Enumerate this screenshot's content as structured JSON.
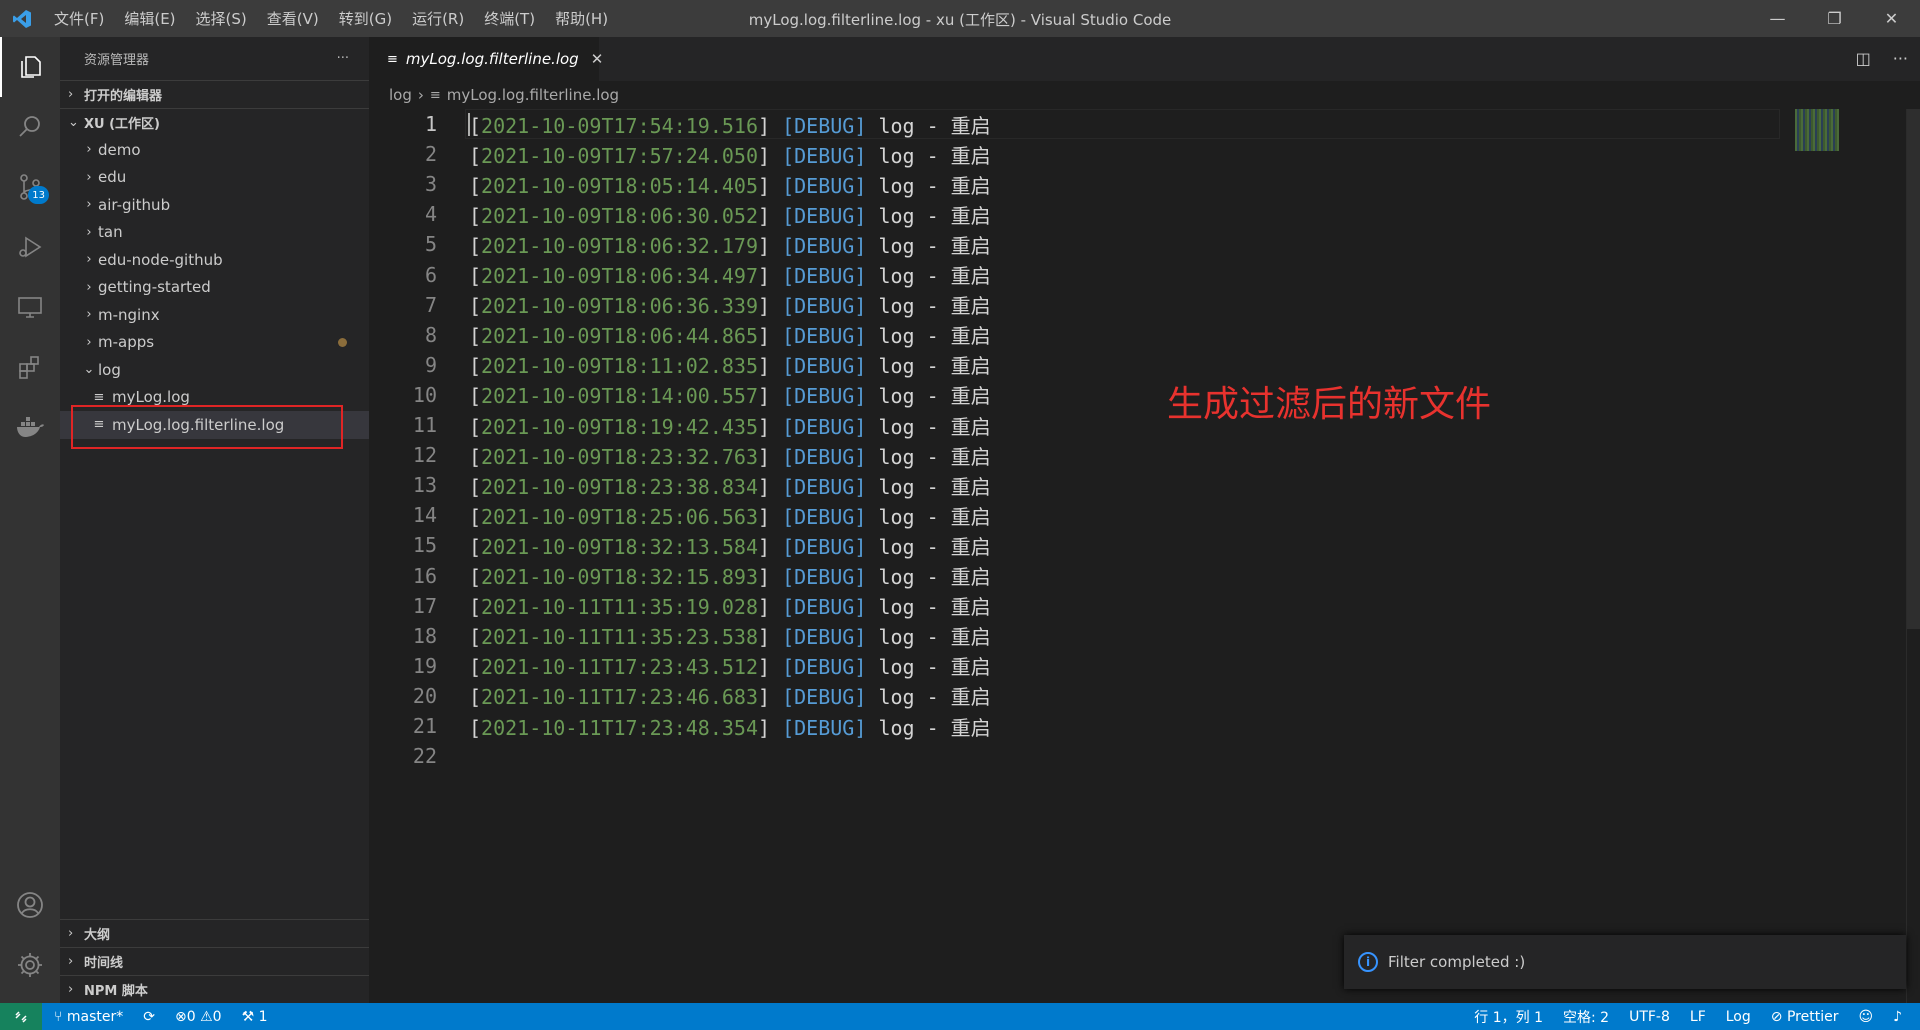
{
  "titlebar": {
    "menu": [
      "文件(F)",
      "编辑(E)",
      "选择(S)",
      "查看(V)",
      "转到(G)",
      "运行(R)",
      "终端(T)",
      "帮助(H)"
    ],
    "window_title": "myLog.log.filterline.log - xu (工作区) - Visual Studio Code"
  },
  "activity_bar": {
    "scm_badge": "13",
    "icons": [
      "explorer-icon",
      "search-icon",
      "source-control-icon",
      "run-debug-icon",
      "remote-explorer-icon",
      "extensions-icon",
      "docker-icon",
      "account-icon",
      "manage-gear-icon"
    ]
  },
  "sidebar": {
    "title": "资源管理器",
    "more": "···",
    "open_editors": "打开的编辑器",
    "workspace": "XU (工作区)",
    "folders": [
      "demo",
      "edu",
      "air-github",
      "tan",
      "edu-node-github",
      "getting-started",
      "m-nginx",
      "m-apps"
    ],
    "log_folder": "log",
    "files": [
      "myLog.log",
      "myLog.log.filterline.log"
    ],
    "bottom_sections": [
      "大纲",
      "时间线",
      "NPM 脚本"
    ]
  },
  "tab": {
    "label": "myLog.log.filterline.log",
    "close": "✕"
  },
  "breadcrumb": {
    "folder": "log",
    "file": "myLog.log.filterline.log"
  },
  "editor": {
    "lines": [
      {
        "n": "1",
        "ts": "2021-10-09T17:54:19.516"
      },
      {
        "n": "2",
        "ts": "2021-10-09T17:57:24.050"
      },
      {
        "n": "3",
        "ts": "2021-10-09T18:05:14.405"
      },
      {
        "n": "4",
        "ts": "2021-10-09T18:06:30.052"
      },
      {
        "n": "5",
        "ts": "2021-10-09T18:06:32.179"
      },
      {
        "n": "6",
        "ts": "2021-10-09T18:06:34.497"
      },
      {
        "n": "7",
        "ts": "2021-10-09T18:06:36.339"
      },
      {
        "n": "8",
        "ts": "2021-10-09T18:06:44.865"
      },
      {
        "n": "9",
        "ts": "2021-10-09T18:11:02.835"
      },
      {
        "n": "10",
        "ts": "2021-10-09T18:14:00.557"
      },
      {
        "n": "11",
        "ts": "2021-10-09T18:19:42.435"
      },
      {
        "n": "12",
        "ts": "2021-10-09T18:23:32.763"
      },
      {
        "n": "13",
        "ts": "2021-10-09T18:23:38.834"
      },
      {
        "n": "14",
        "ts": "2021-10-09T18:25:06.563"
      },
      {
        "n": "15",
        "ts": "2021-10-09T18:32:13.584"
      },
      {
        "n": "16",
        "ts": "2021-10-09T18:32:15.893"
      },
      {
        "n": "17",
        "ts": "2021-10-11T11:35:19.028"
      },
      {
        "n": "18",
        "ts": "2021-10-11T11:35:23.538"
      },
      {
        "n": "19",
        "ts": "2021-10-11T17:23:43.512"
      },
      {
        "n": "20",
        "ts": "2021-10-11T17:23:46.683"
      },
      {
        "n": "21",
        "ts": "2021-10-11T17:23:48.354"
      },
      {
        "n": "22",
        "ts": ""
      }
    ],
    "level": "[DEBUG]",
    "message": "log - 重启"
  },
  "annotation": "生成过滤后的新文件",
  "notification": "Filter completed :)",
  "statusbar": {
    "branch": "master*",
    "errors": "0",
    "warnings": "0",
    "ports": "1",
    "position": "行 1，列 1",
    "spaces": "空格: 2",
    "encoding": "UTF-8",
    "eol": "LF",
    "language": "Log",
    "prettier": "Prettier"
  }
}
